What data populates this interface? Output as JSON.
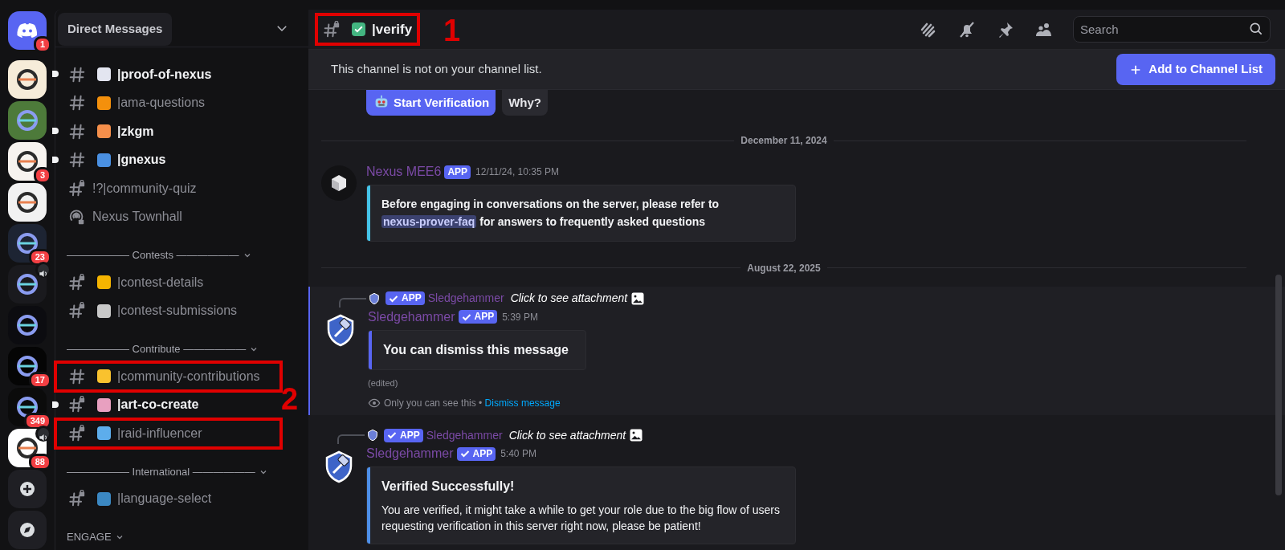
{
  "servers": [
    {
      "kind": "home",
      "color": "#5865f2",
      "badge": "1",
      "voice": false,
      "tooltip": "Direct Messages"
    },
    {
      "kind": "server",
      "color": "#f6ecd9",
      "voice": false
    },
    {
      "kind": "server",
      "color": "#4d7a3a",
      "voice": false
    },
    {
      "kind": "server",
      "color": "#f7f3ef",
      "badge": "3",
      "voice": false
    },
    {
      "kind": "server",
      "color": "#f2f2f2",
      "voice": false
    },
    {
      "kind": "server",
      "color": "#1d2433",
      "badge": "23",
      "voice": false
    },
    {
      "kind": "server",
      "color": "#1a1a1e",
      "voice": true
    },
    {
      "kind": "server",
      "color": "#0c0c10",
      "voice": false
    },
    {
      "kind": "server",
      "color": "#050505",
      "badge": "17",
      "voice": false
    },
    {
      "kind": "server",
      "color": "#0b0b0b",
      "badge": "349",
      "voice": false
    },
    {
      "kind": "server",
      "color": "#ffffff",
      "badge": "88",
      "voice": true
    },
    {
      "kind": "add",
      "color": "#1f1f24",
      "voice": false
    },
    {
      "kind": "discover",
      "color": "#1f1f24",
      "voice": false
    }
  ],
  "channels": [
    {
      "kind": "text",
      "label": "|proof-of-nexus",
      "unread": true,
      "color": "#e3e5f0",
      "boxed": false
    },
    {
      "kind": "text",
      "label": "|ama-questions",
      "unread": false,
      "color": "#f4900c",
      "boxed": false
    },
    {
      "kind": "text",
      "label": "|zkgm",
      "unread": true,
      "color": "#f58f4b",
      "boxed": false
    },
    {
      "kind": "text",
      "label": "|gnexus",
      "unread": true,
      "color": "#4a90e2",
      "boxed": false
    },
    {
      "kind": "locked",
      "label": "!?|community-quiz",
      "unread": false,
      "boxed": false
    },
    {
      "kind": "voice",
      "label": "Nexus Townhall",
      "unread": false,
      "boxed": false
    },
    {
      "kind": "category",
      "label": "—————— Contests ——————"
    },
    {
      "kind": "locked",
      "label": "|contest-details",
      "unread": false,
      "color": "#f5b400",
      "boxed": false
    },
    {
      "kind": "locked",
      "label": "|contest-submissions",
      "unread": false,
      "color": "#c8c8c8",
      "boxed": false
    },
    {
      "kind": "category",
      "label": "—————— Contribute ——————"
    },
    {
      "kind": "text",
      "label": "|community-contributions",
      "unread": false,
      "color": "#f9c22e",
      "boxed": true
    },
    {
      "kind": "locked",
      "label": "|art-co-create",
      "unread": true,
      "color": "#e8a0c0",
      "boxed": false
    },
    {
      "kind": "locked",
      "label": "|raid-influencer",
      "unread": false,
      "color": "#5dadec",
      "boxed": true
    },
    {
      "kind": "category",
      "label": "—————— International ——————"
    },
    {
      "kind": "locked",
      "label": "|language-select",
      "unread": false,
      "color": "#3b88c3",
      "boxed": false
    },
    {
      "kind": "category",
      "label": "ENGAGE"
    }
  ],
  "header": {
    "channel": "|verify",
    "color": "#43b581",
    "boxed": true,
    "search": {
      "placeholder": "Search"
    }
  },
  "notice": {
    "text": "This channel is not on your channel list.",
    "button": "Add to Channel List"
  },
  "annotations": [
    {
      "label": "1"
    },
    {
      "label": "2"
    }
  ],
  "messages": [
    {
      "kind": "buttons",
      "buttons": [
        {
          "label": "Start Verification"
        },
        {
          "label": "Why?"
        }
      ]
    },
    {
      "kind": "divider",
      "label": "December 11, 2024"
    },
    {
      "kind": "message",
      "author": "Nexus MEE6",
      "tag": "APP",
      "verified": false,
      "time": "12/11/24, 10:35 PM",
      "ephemeral": false,
      "embed": {
        "color": "#45c3e8",
        "before": "Before engaging in conversations on the server, please refer to",
        "mention": "nexus-prover-faq",
        "after": "for answers to frequently asked questions"
      }
    },
    {
      "kind": "divider",
      "label": "August 22, 2025"
    },
    {
      "kind": "message",
      "reply": {
        "tag": "APP",
        "verified": true,
        "author": "Sledgehammer",
        "text": "Click to see attachment"
      },
      "author": "Sledgehammer",
      "tag": "APP",
      "verified": true,
      "time": "5:39 PM",
      "ephemeral": true,
      "embed": {
        "color": "#5865f2",
        "title": "You can dismiss this message"
      },
      "edited": "(edited)",
      "note": {
        "text": "Only you can see this",
        "sep": "•",
        "action": "Dismiss message"
      }
    },
    {
      "kind": "message",
      "reply": {
        "tag": "APP",
        "verified": true,
        "author": "Sledgehammer",
        "text": "Click to see attachment"
      },
      "author": "Sledgehammer",
      "tag": "APP",
      "verified": true,
      "time": "5:40 PM",
      "ephemeral": false,
      "embed": {
        "color": "#4e8fe8",
        "title": "Verified Successfully!",
        "description": "You are verified, it might take a while to get your role due to the big flow of users requesting verification in this server right now, please be patient!"
      }
    }
  ]
}
